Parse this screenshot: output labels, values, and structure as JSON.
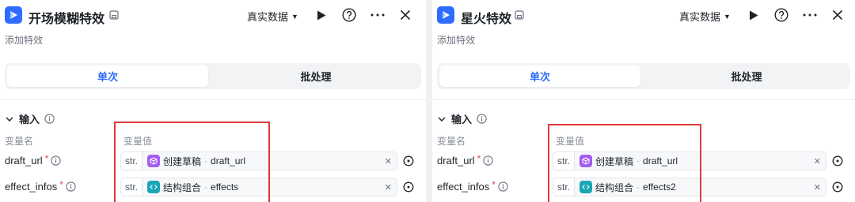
{
  "panels": [
    {
      "title": "开场模糊特效",
      "subtitle": "添加特效",
      "data_select": "真实数据",
      "tabs": [
        "单次",
        "批处理"
      ],
      "section": "输入",
      "col_name": "变量名",
      "col_value": "变量值",
      "params": [
        {
          "name": "draft_url",
          "type": "str.",
          "node": "创建草稿",
          "node_icon": "box-icon",
          "node_color": "#a55cf0",
          "field": "draft_url"
        },
        {
          "name": "effect_infos",
          "type": "str.",
          "node": "结构组合",
          "node_icon": "code-icon",
          "node_color": "#1aa7b5",
          "field": "effects"
        }
      ],
      "highlight_color": "#e03a3a"
    },
    {
      "title": "星火特效",
      "subtitle": "添加特效",
      "data_select": "真实数据",
      "tabs": [
        "单次",
        "批处理"
      ],
      "section": "输入",
      "col_name": "变量名",
      "col_value": "变量值",
      "params": [
        {
          "name": "draft_url",
          "type": "str.",
          "node": "创建草稿",
          "node_icon": "box-icon",
          "node_color": "#a55cf0",
          "field": "draft_url"
        },
        {
          "name": "effect_infos",
          "type": "str.",
          "node": "结构组合",
          "node_icon": "code-icon",
          "node_color": "#1aa7b5",
          "field": "effects2"
        }
      ],
      "highlight_color": "#e03a3a"
    }
  ],
  "colors": {
    "accent": "#2f6bff",
    "required": "#e5484d"
  }
}
